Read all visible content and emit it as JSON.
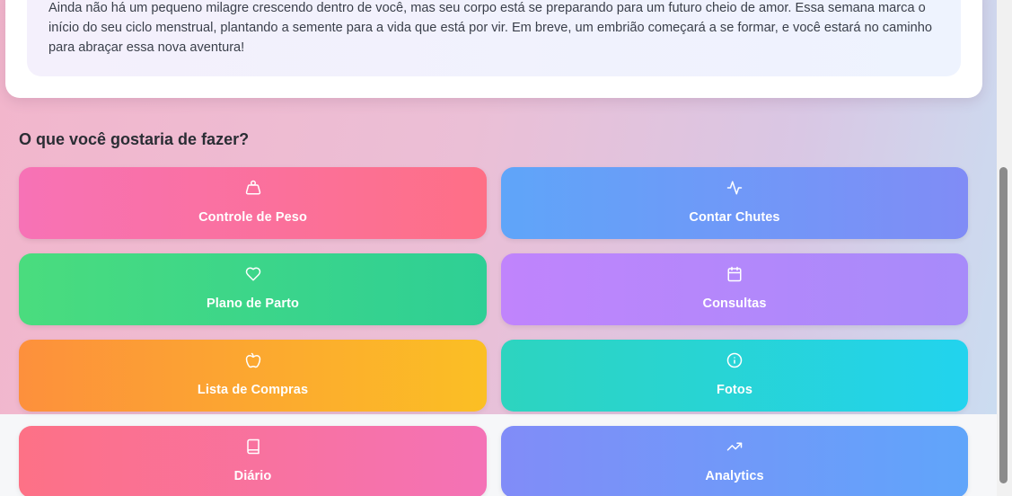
{
  "intro": {
    "text": "Ainda não há um pequeno milagre crescendo dentro de você, mas seu corpo está se preparando para um futuro cheio de amor. Essa semana marca o início do seu ciclo menstrual, plantando a semente para a vida que está por vir. Em breve, um embrião começará a se formar, e você estará no caminho para abraçar essa nova aventura!"
  },
  "actions_section": {
    "title": "O que você gostaria de fazer?",
    "items": [
      {
        "label": "Controle de Peso",
        "icon": "weight-icon",
        "gradient": [
          "#f772b6",
          "#fe6f86"
        ]
      },
      {
        "label": "Contar Chutes",
        "icon": "activity-icon",
        "gradient": [
          "#5fa5f9",
          "#808cf6"
        ]
      },
      {
        "label": "Plano de Parto",
        "icon": "heart-icon",
        "gradient": [
          "#4adc7e",
          "#2ecf95"
        ]
      },
      {
        "label": "Consultas",
        "icon": "calendar-icon",
        "gradient": [
          "#c084fc",
          "#a78bfa"
        ]
      },
      {
        "label": "Lista de Compras",
        "icon": "apple-icon",
        "gradient": [
          "#fd903c",
          "#fbbf24"
        ]
      },
      {
        "label": "Fotos",
        "icon": "info-icon",
        "gradient": [
          "#2dd4bf",
          "#22d3ee"
        ]
      },
      {
        "label": "Diário",
        "icon": "book-icon",
        "gradient": [
          "#fd7186",
          "#f472b6"
        ]
      },
      {
        "label": "Analytics",
        "icon": "trending-up-icon",
        "gradient": [
          "#818cf8",
          "#60a5fa"
        ]
      }
    ]
  }
}
